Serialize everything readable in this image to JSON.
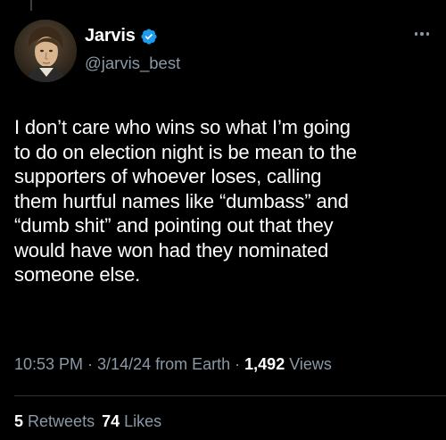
{
  "author": {
    "display_name": "Jarvis",
    "handle": "@jarvis_best",
    "verified": true,
    "verified_color": "#1d9bf0"
  },
  "tweet": {
    "text": "I don’t care who wins so what I’m going\nto do on election night is be mean to the\nsupporters of whoever loses, calling\nthem hurtful names like “dumbass” and\n“dumb shit” and pointing out that they\nwould have won had they nominated\nsomeone else."
  },
  "meta": {
    "time": "10:53 PM",
    "separator": " · ",
    "date": "3/14/24",
    "source": "from Earth",
    "views_count": "1,492",
    "views_label": "Views"
  },
  "stats": {
    "retweets_count": "5",
    "retweets_label": "Retweets",
    "likes_count": "74",
    "likes_label": "Likes"
  },
  "icons": {
    "more": "more-options-icon",
    "verified": "verified-badge-icon"
  },
  "colors": {
    "background": "#000000",
    "primary_text": "#ffffff",
    "secondary_text": "#8b98a5",
    "divider": "#2f3336"
  }
}
